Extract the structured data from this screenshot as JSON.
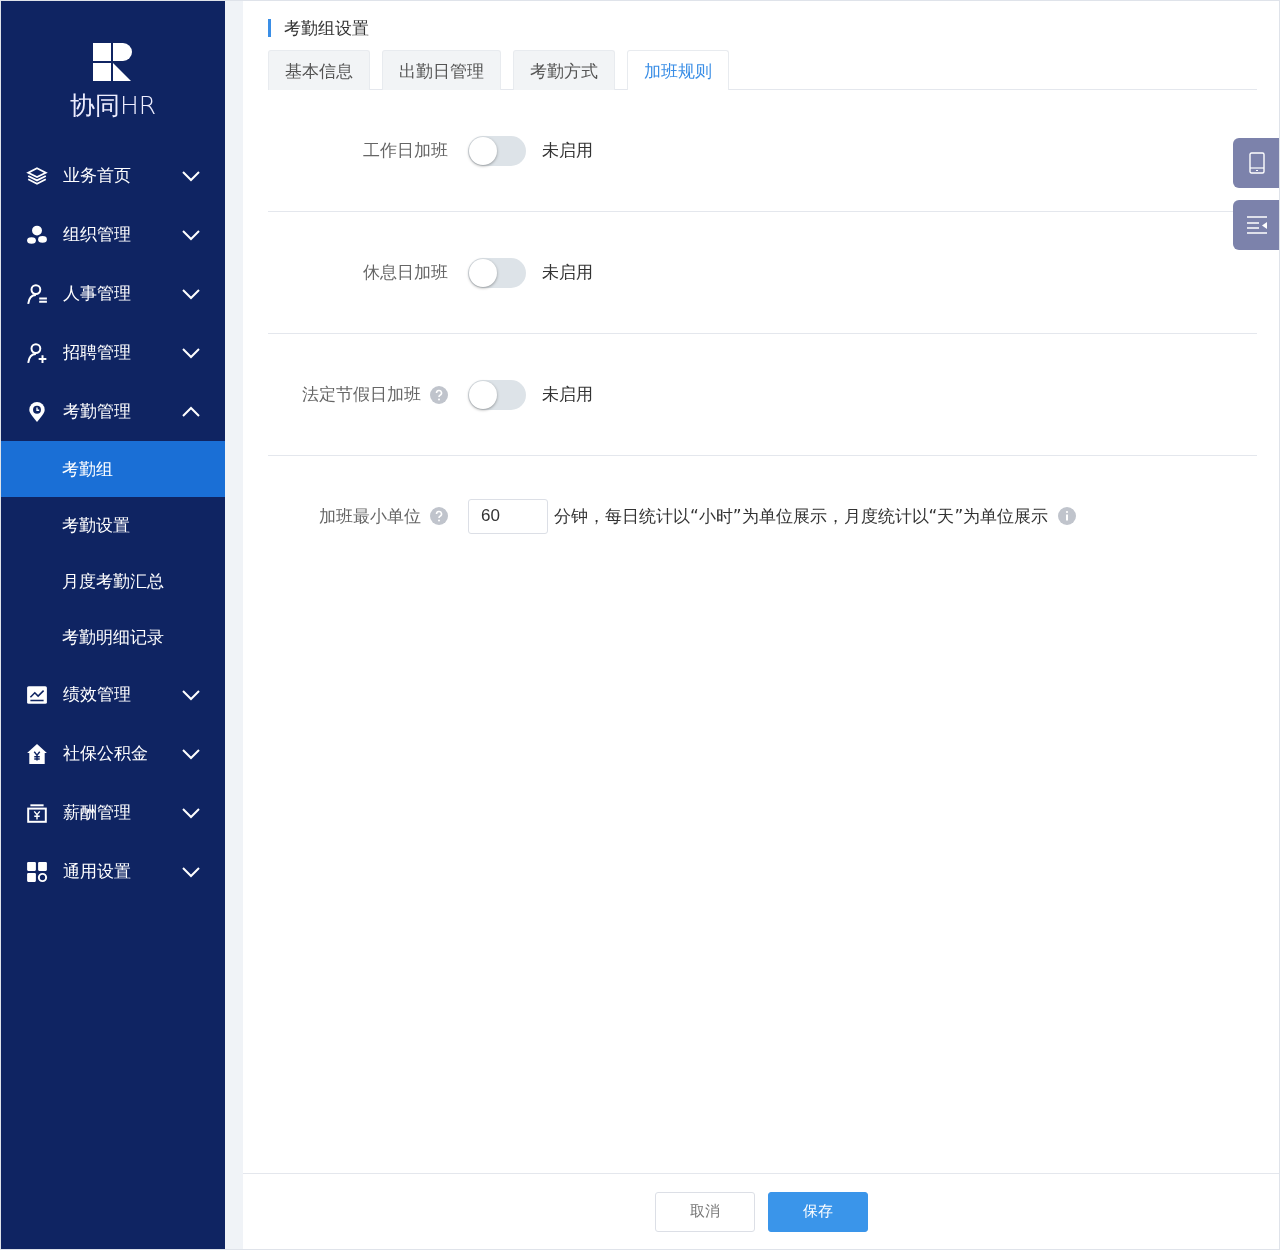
{
  "sidebar": {
    "logo": "协同HR",
    "items": [
      {
        "label": "业务首页",
        "expanded": false
      },
      {
        "label": "组织管理",
        "expanded": false
      },
      {
        "label": "人事管理",
        "expanded": false
      },
      {
        "label": "招聘管理",
        "expanded": false
      },
      {
        "label": "考勤管理",
        "expanded": true,
        "children": [
          {
            "label": "考勤组",
            "selected": true
          },
          {
            "label": "考勤设置",
            "selected": false
          },
          {
            "label": "月度考勤汇总",
            "selected": false
          },
          {
            "label": "考勤明细记录",
            "selected": false
          }
        ]
      },
      {
        "label": "绩效管理",
        "expanded": false
      },
      {
        "label": "社保公积金",
        "expanded": false
      },
      {
        "label": "薪酬管理",
        "expanded": false
      },
      {
        "label": "通用设置",
        "expanded": false
      }
    ]
  },
  "page": {
    "title": "考勤组设置"
  },
  "tabs": [
    {
      "label": "基本信息",
      "selected": false
    },
    {
      "label": "出勤日管理",
      "selected": false
    },
    {
      "label": "考勤方式",
      "selected": false
    },
    {
      "label": "加班规则",
      "selected": true
    }
  ],
  "settings": [
    {
      "kind": "toggle",
      "label": "工作日加班",
      "help": false,
      "on": false,
      "status": "未启用"
    },
    {
      "kind": "toggle",
      "label": "休息日加班",
      "help": false,
      "on": false,
      "status": "未启用"
    },
    {
      "kind": "toggle",
      "label": "法定节假日加班",
      "help": true,
      "on": false,
      "status": "未启用"
    },
    {
      "kind": "number",
      "label": "加班最小单位",
      "help": true,
      "value": "60",
      "note": "分钟，每日统计以“小时”为单位展示，月度统计以“天”为单位展示",
      "info": true
    }
  ],
  "buttons": [
    {
      "label": "取消",
      "kind": "secondary"
    },
    {
      "label": "保存",
      "kind": "primary"
    }
  ]
}
